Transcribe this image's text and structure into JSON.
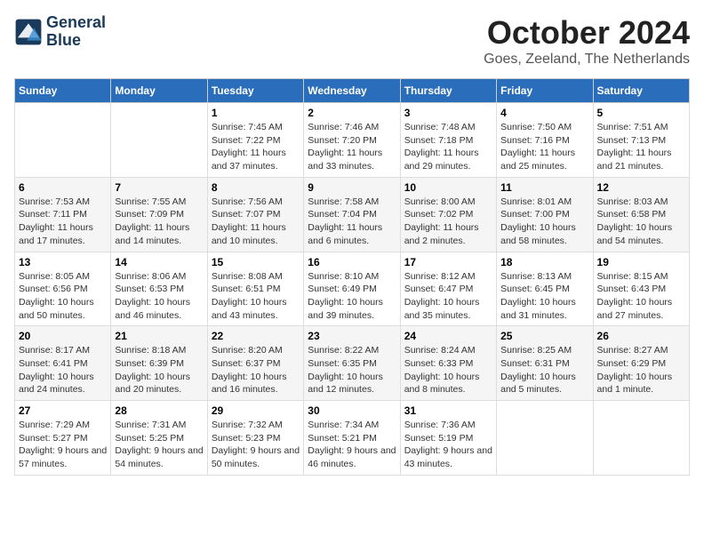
{
  "logo": {
    "line1": "General",
    "line2": "Blue"
  },
  "title": "October 2024",
  "subtitle": "Goes, Zeeland, The Netherlands",
  "days_of_week": [
    "Sunday",
    "Monday",
    "Tuesday",
    "Wednesday",
    "Thursday",
    "Friday",
    "Saturday"
  ],
  "weeks": [
    [
      {
        "day": "",
        "detail": ""
      },
      {
        "day": "",
        "detail": ""
      },
      {
        "day": "1",
        "detail": "Sunrise: 7:45 AM\nSunset: 7:22 PM\nDaylight: 11 hours and 37 minutes."
      },
      {
        "day": "2",
        "detail": "Sunrise: 7:46 AM\nSunset: 7:20 PM\nDaylight: 11 hours and 33 minutes."
      },
      {
        "day": "3",
        "detail": "Sunrise: 7:48 AM\nSunset: 7:18 PM\nDaylight: 11 hours and 29 minutes."
      },
      {
        "day": "4",
        "detail": "Sunrise: 7:50 AM\nSunset: 7:16 PM\nDaylight: 11 hours and 25 minutes."
      },
      {
        "day": "5",
        "detail": "Sunrise: 7:51 AM\nSunset: 7:13 PM\nDaylight: 11 hours and 21 minutes."
      }
    ],
    [
      {
        "day": "6",
        "detail": "Sunrise: 7:53 AM\nSunset: 7:11 PM\nDaylight: 11 hours and 17 minutes."
      },
      {
        "day": "7",
        "detail": "Sunrise: 7:55 AM\nSunset: 7:09 PM\nDaylight: 11 hours and 14 minutes."
      },
      {
        "day": "8",
        "detail": "Sunrise: 7:56 AM\nSunset: 7:07 PM\nDaylight: 11 hours and 10 minutes."
      },
      {
        "day": "9",
        "detail": "Sunrise: 7:58 AM\nSunset: 7:04 PM\nDaylight: 11 hours and 6 minutes."
      },
      {
        "day": "10",
        "detail": "Sunrise: 8:00 AM\nSunset: 7:02 PM\nDaylight: 11 hours and 2 minutes."
      },
      {
        "day": "11",
        "detail": "Sunrise: 8:01 AM\nSunset: 7:00 PM\nDaylight: 10 hours and 58 minutes."
      },
      {
        "day": "12",
        "detail": "Sunrise: 8:03 AM\nSunset: 6:58 PM\nDaylight: 10 hours and 54 minutes."
      }
    ],
    [
      {
        "day": "13",
        "detail": "Sunrise: 8:05 AM\nSunset: 6:56 PM\nDaylight: 10 hours and 50 minutes."
      },
      {
        "day": "14",
        "detail": "Sunrise: 8:06 AM\nSunset: 6:53 PM\nDaylight: 10 hours and 46 minutes."
      },
      {
        "day": "15",
        "detail": "Sunrise: 8:08 AM\nSunset: 6:51 PM\nDaylight: 10 hours and 43 minutes."
      },
      {
        "day": "16",
        "detail": "Sunrise: 8:10 AM\nSunset: 6:49 PM\nDaylight: 10 hours and 39 minutes."
      },
      {
        "day": "17",
        "detail": "Sunrise: 8:12 AM\nSunset: 6:47 PM\nDaylight: 10 hours and 35 minutes."
      },
      {
        "day": "18",
        "detail": "Sunrise: 8:13 AM\nSunset: 6:45 PM\nDaylight: 10 hours and 31 minutes."
      },
      {
        "day": "19",
        "detail": "Sunrise: 8:15 AM\nSunset: 6:43 PM\nDaylight: 10 hours and 27 minutes."
      }
    ],
    [
      {
        "day": "20",
        "detail": "Sunrise: 8:17 AM\nSunset: 6:41 PM\nDaylight: 10 hours and 24 minutes."
      },
      {
        "day": "21",
        "detail": "Sunrise: 8:18 AM\nSunset: 6:39 PM\nDaylight: 10 hours and 20 minutes."
      },
      {
        "day": "22",
        "detail": "Sunrise: 8:20 AM\nSunset: 6:37 PM\nDaylight: 10 hours and 16 minutes."
      },
      {
        "day": "23",
        "detail": "Sunrise: 8:22 AM\nSunset: 6:35 PM\nDaylight: 10 hours and 12 minutes."
      },
      {
        "day": "24",
        "detail": "Sunrise: 8:24 AM\nSunset: 6:33 PM\nDaylight: 10 hours and 8 minutes."
      },
      {
        "day": "25",
        "detail": "Sunrise: 8:25 AM\nSunset: 6:31 PM\nDaylight: 10 hours and 5 minutes."
      },
      {
        "day": "26",
        "detail": "Sunrise: 8:27 AM\nSunset: 6:29 PM\nDaylight: 10 hours and 1 minute."
      }
    ],
    [
      {
        "day": "27",
        "detail": "Sunrise: 7:29 AM\nSunset: 5:27 PM\nDaylight: 9 hours and 57 minutes."
      },
      {
        "day": "28",
        "detail": "Sunrise: 7:31 AM\nSunset: 5:25 PM\nDaylight: 9 hours and 54 minutes."
      },
      {
        "day": "29",
        "detail": "Sunrise: 7:32 AM\nSunset: 5:23 PM\nDaylight: 9 hours and 50 minutes."
      },
      {
        "day": "30",
        "detail": "Sunrise: 7:34 AM\nSunset: 5:21 PM\nDaylight: 9 hours and 46 minutes."
      },
      {
        "day": "31",
        "detail": "Sunrise: 7:36 AM\nSunset: 5:19 PM\nDaylight: 9 hours and 43 minutes."
      },
      {
        "day": "",
        "detail": ""
      },
      {
        "day": "",
        "detail": ""
      }
    ]
  ]
}
